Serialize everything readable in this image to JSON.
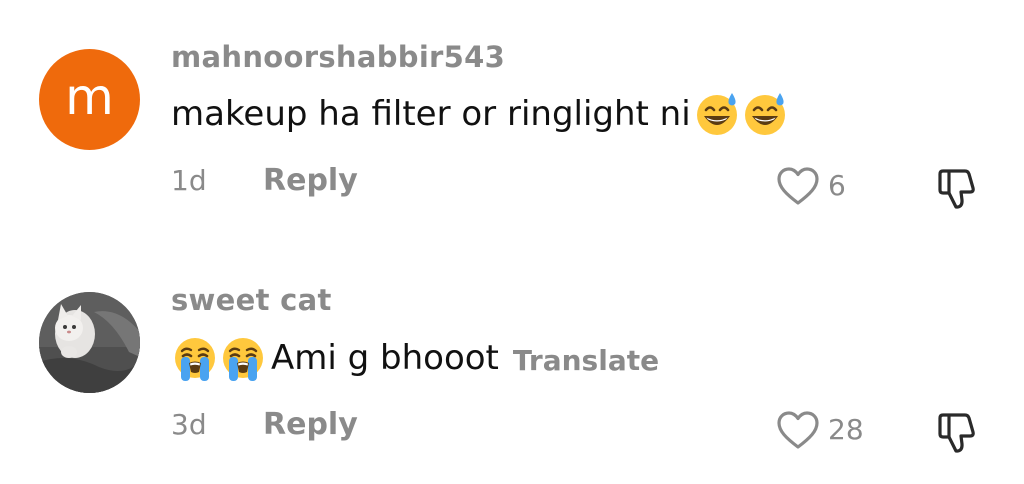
{
  "comments": [
    {
      "avatar_letter": "m",
      "avatar_color": "#ef6a0c",
      "username": "mahnoorshabbir543",
      "text": "makeup ha filter or ringlight ni",
      "emojis": [
        "sweat-smile-emoji",
        "sweat-smile-emoji"
      ],
      "time": "1d",
      "reply_label": "Reply",
      "like_count": "6"
    },
    {
      "avatar_image": "cat-photo-avatar",
      "username": "sweet cat",
      "emojis": [
        "loudly-crying-emoji",
        "loudly-crying-emoji"
      ],
      "text": "Ami g bhooot",
      "translate_label": "Translate",
      "time": "3d",
      "reply_label": "Reply",
      "like_count": "28"
    }
  ],
  "colors": {
    "secondary_text": "#8a8a8a",
    "primary_text": "#111111",
    "background": "#ffffff"
  }
}
